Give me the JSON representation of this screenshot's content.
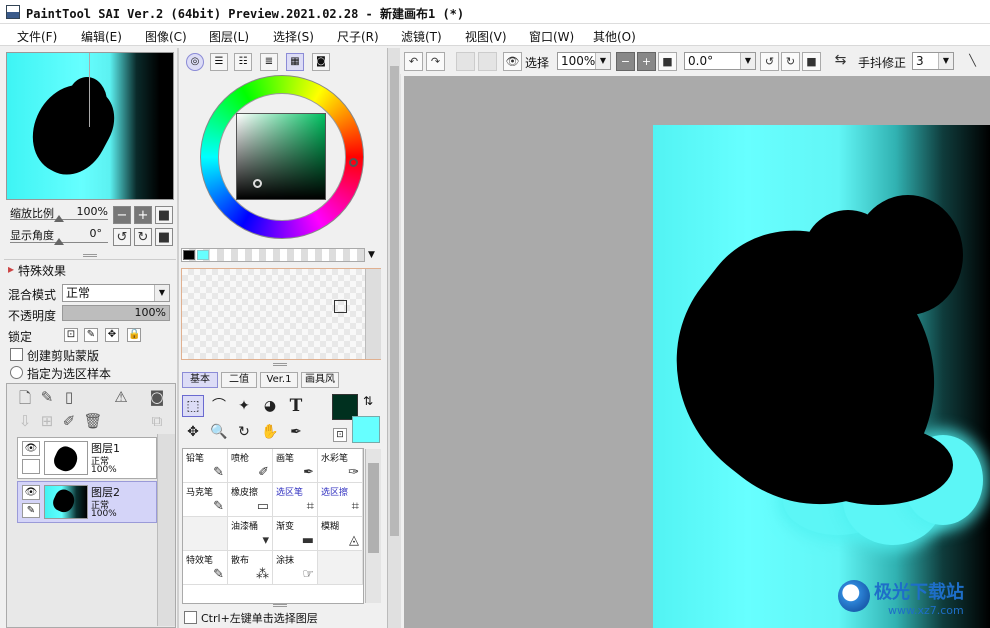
{
  "window": {
    "title": "PaintTool SAI Ver.2 (64bit) Preview.2021.02.28 - 新建画布1 (*)"
  },
  "menu": [
    {
      "label": "文件(F)"
    },
    {
      "label": "编辑(E)"
    },
    {
      "label": "图像(C)"
    },
    {
      "label": "图层(L)"
    },
    {
      "label": "选择(S)"
    },
    {
      "label": "尺子(R)"
    },
    {
      "label": "滤镜(T)"
    },
    {
      "label": "视图(V)"
    },
    {
      "label": "窗口(W)"
    },
    {
      "label": "其他(O)"
    }
  ],
  "navigator": {
    "zoom_label": "缩放比例",
    "zoom_value": "100%",
    "zoom_level": 0.5,
    "angle_label": "显示角度",
    "angle_value": "0°",
    "angle_level": 0.5
  },
  "layer_props": {
    "special_effects": "特殊效果",
    "blend_label": "混合模式",
    "blend_value": "正常",
    "opacity_label": "不透明度",
    "opacity_value": "100%",
    "opacity_fraction": 1.0,
    "lock_label": "锁定",
    "clip_label": "创建剪贴蒙版",
    "selection_source_label": "指定为选区样本"
  },
  "layers": [
    {
      "name": "图层1",
      "mode": "正常",
      "opacity": "100%",
      "selected": false
    },
    {
      "name": "图层2",
      "mode": "正常",
      "opacity": "100%",
      "selected": true
    }
  ],
  "color": {
    "foreground": "#00301f",
    "background": "#66ffff",
    "swatches": [
      "#000000",
      "#66ffff"
    ]
  },
  "tool_tabs": [
    {
      "label": "基本",
      "active": true
    },
    {
      "label": "二值",
      "active": false
    },
    {
      "label": "Ver.1",
      "active": false
    },
    {
      "label": "画具风",
      "active": false
    }
  ],
  "brushes": [
    {
      "label": "铅笔",
      "blue": false
    },
    {
      "label": "喷枪",
      "blue": false
    },
    {
      "label": "画笔",
      "blue": false
    },
    {
      "label": "水彩笔",
      "blue": false
    },
    {
      "label": "马克笔",
      "blue": false
    },
    {
      "label": "橡皮擦",
      "blue": false
    },
    {
      "label": "选区笔",
      "blue": true
    },
    {
      "label": "选区擦",
      "blue": true
    },
    {
      "label": "",
      "blue": false
    },
    {
      "label": "油漆桶",
      "blue": false
    },
    {
      "label": "渐变",
      "blue": false
    },
    {
      "label": "模糊",
      "blue": false
    },
    {
      "label": "特效笔",
      "blue": false
    },
    {
      "label": "散布",
      "blue": false
    },
    {
      "label": "涂抹",
      "blue": false
    },
    {
      "label": "",
      "blue": false
    }
  ],
  "ctrl_click_label": "Ctrl+左键单击选择图层",
  "canvas_toolbar": {
    "select_label": "选择",
    "zoom_value": "100%",
    "rotation_value": "0.0°",
    "stabilizer_label": "手抖修正",
    "stabilizer_value": "3"
  },
  "watermark": {
    "text": "极光下载站",
    "url": "www.xz7.com"
  }
}
